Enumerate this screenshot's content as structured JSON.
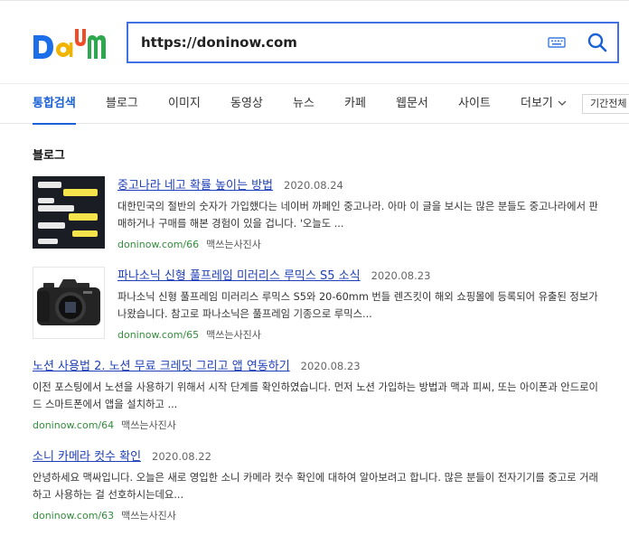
{
  "search": {
    "query": "https://doninow.com"
  },
  "nav": {
    "tabs": [
      {
        "label": "통합검색",
        "active": true
      },
      {
        "label": "블로그"
      },
      {
        "label": "이미지"
      },
      {
        "label": "동영상"
      },
      {
        "label": "뉴스"
      },
      {
        "label": "카페"
      },
      {
        "label": "웹문서"
      },
      {
        "label": "사이트"
      },
      {
        "label": "더보기"
      }
    ],
    "period_label": "기간전체"
  },
  "section": {
    "title": "블로그"
  },
  "results": [
    {
      "title": "중고나라 네고 확률 높이는 방법",
      "date": "2020.08.24",
      "desc": "대한민국의 절반의 숫자가 가입했다는 네이버 까페인 중고나라. 아마 이 글을 보시는 많은 분들도 중고나라에서 판매하거나 구매를 해본 경험이 있을 겁니다. '오늘도 ...",
      "url": "doninow.com/66",
      "author": "맥쓰는사진사",
      "thumb": "chat"
    },
    {
      "title": "파나소닉 신형 풀프레임 미러리스 루믹스 S5 소식",
      "date": "2020.08.23",
      "desc": "파나소닉 신형 풀프레임 미러리스 루믹스 S5와 20-60mm 번들 렌즈킷이 해외 쇼핑몰에 등록되어 유출된 정보가 나왔습니다. 참고로 파나소닉은 풀프레임 기종으로 루믹스...",
      "url": "doninow.com/65",
      "author": "맥쓰는사진사",
      "thumb": "camera"
    },
    {
      "title": "노션 사용법 2. 노션 무료 크레딧 그리고 앱 연동하기",
      "date": "2020.08.23",
      "desc": "이전 포스팅에서 노션을 사용하기 위해서 시작 단계를 확인하였습니다. 먼저 노션 가입하는 방법과 맥과 피씨, 또는 아이폰과 안드로이드 스마트폰에서 앱을 설치하고 ...",
      "url": "doninow.com/64",
      "author": "맥쓰는사진사"
    },
    {
      "title": "소니 카메라 컷수 확인",
      "date": "2020.08.22",
      "desc": "안녕하세요 맥싸입니다. 오늘은 새로 영입한 소니 카메라 컷수 확인에 대하여 알아보려고 합니다. 많은 분들이 전자기기를 중고로 거래하고 사용하는 걸 선호하시는데요...",
      "url": "doninow.com/63",
      "author": "맥쓰는사진사"
    }
  ]
}
